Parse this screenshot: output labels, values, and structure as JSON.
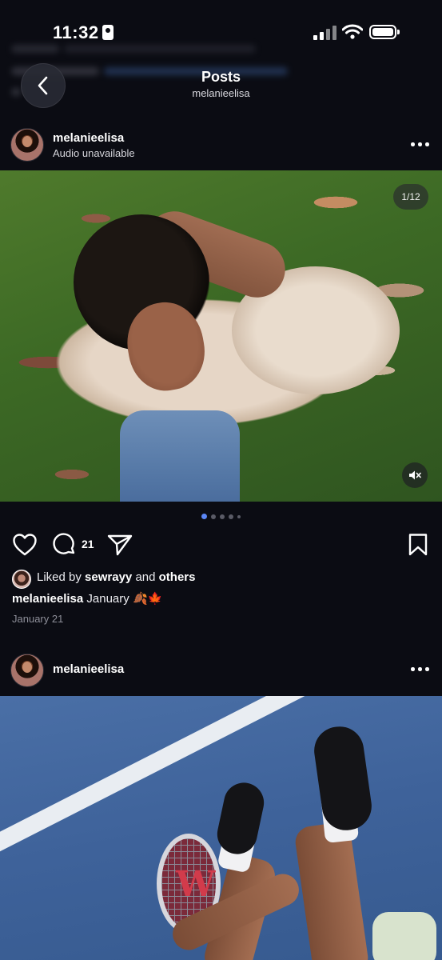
{
  "status_bar": {
    "time": "11:32"
  },
  "nav": {
    "back_label": "Back",
    "title": "Posts",
    "subtitle": "melanieelisa"
  },
  "posts": [
    {
      "username": "melanieelisa",
      "audio_status": "Audio unavailable",
      "media_counter": "1/12",
      "carousel": {
        "current": 1,
        "total": 12
      },
      "comment_count": "21",
      "liked_by_prefix": "Liked by",
      "liked_by_user": "sewrayy",
      "liked_by_and": "and",
      "liked_by_others": "others",
      "caption_user": "melanieelisa",
      "caption_text": "January 🍂🍁",
      "date": "January 21"
    },
    {
      "username": "melanieelisa"
    }
  ],
  "icons": {
    "back": "chevron-left-icon",
    "more": "more-horizontal-icon",
    "like": "heart-icon",
    "comment": "comment-icon",
    "share": "send-icon",
    "save": "bookmark-icon",
    "mute": "speaker-muted-icon"
  },
  "colors": {
    "background": "#0b0c13",
    "accent_dot": "#5b86f5",
    "muted_text": "#8e8f99"
  }
}
